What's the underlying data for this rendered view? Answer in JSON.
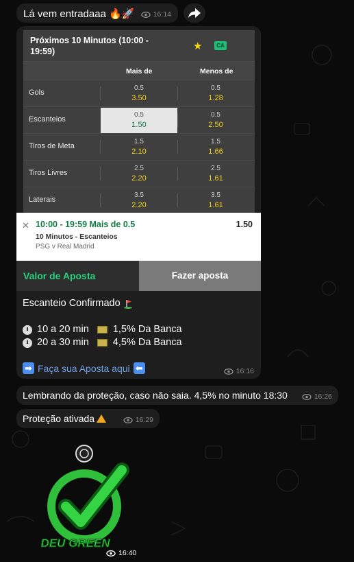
{
  "messages": {
    "first": {
      "text": "Lá vem entradaaa 🔥🚀",
      "time": "16:14"
    },
    "card": {
      "panel_title": "Próximos 10 Minutos (10:00 - 19:59)",
      "badge": "CA",
      "col_over": "Mais de",
      "col_under": "Menos de",
      "rows": [
        {
          "label": "Gols",
          "over_line": "0.5",
          "over_odd": "3.50",
          "under_line": "0.5",
          "under_odd": "1.28"
        },
        {
          "label": "Escanteios",
          "over_line": "0.5",
          "over_odd": "1.50",
          "under_line": "0.5",
          "under_odd": "2.50"
        },
        {
          "label": "Tiros de Meta",
          "over_line": "1.5",
          "over_odd": "2.10",
          "under_line": "1.5",
          "under_odd": "1.66"
        },
        {
          "label": "Tiros Livres",
          "over_line": "2.5",
          "over_odd": "2.20",
          "under_line": "2.5",
          "under_odd": "1.61"
        },
        {
          "label": "Laterais",
          "over_line": "3.5",
          "over_odd": "2.20",
          "under_line": "3.5",
          "under_odd": "1.61"
        }
      ],
      "slip": {
        "selection": "10:00 - 19:59 Mais de  0.5",
        "odd": "1.50",
        "market": "10 Minutos - Escanteios",
        "event": "PSG v Real Madrid"
      },
      "stake_label": "Valor de Aposta",
      "place_bet": "Fazer aposta",
      "caption_title": "Escanteio Confirmado",
      "line1_time": "10 a 20 min",
      "line1_stake": "1,5% Da Banca",
      "line2_time": "20 a 30 min",
      "line2_stake": "4,5% Da Banca",
      "link_text": "Faça sua Aposta aqui",
      "time": "16:16"
    },
    "third": {
      "text": "Lembrando da proteção, caso não saia. 4,5% no minuto 18:30",
      "time": "16:26"
    },
    "fourth": {
      "text": "Proteção ativada",
      "time": "16:29"
    },
    "sticker": {
      "text": "DEU GREEN",
      "time": "16:40"
    }
  },
  "colors": {
    "accent_green": "#2bd07e",
    "odd_yellow": "#f2d21b",
    "link_blue": "#6f9fe6"
  }
}
